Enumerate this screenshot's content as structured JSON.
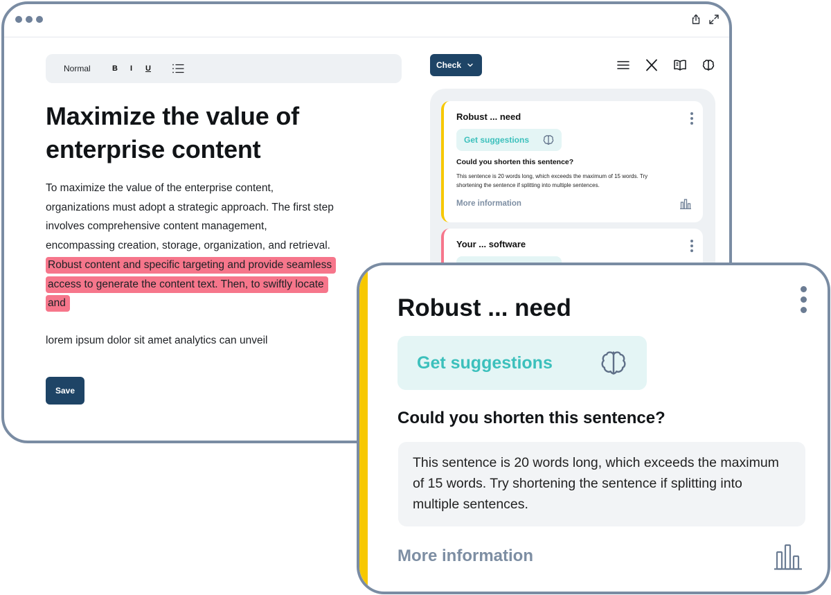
{
  "toolbar": {
    "style_label": "Normal",
    "bold": "B",
    "italic": "I",
    "underline": "U"
  },
  "document": {
    "title": "Maximize the value of enterprise content",
    "body_plain": "To maximize the value of the enterprise content, organizations must adopt a strategic approach. The first step involves comprehensive content management, encompassing creation, storage, organization, and retrieval.",
    "body_highlight": "Robust content and specific targeting and provide seamless access to generate the content text. Then, to swiftly locate and",
    "extra": "lorem ipsum dolor sit amet analytics can unveil",
    "save_label": "Save"
  },
  "panel": {
    "check_label": "Check",
    "cards": [
      {
        "title": "Robust ... need",
        "suggest_label": "Get suggestions",
        "question": "Could you shorten this sentence?",
        "description": "This sentence is 20 words long, which exceeds the maximum of 15 words. Try shortening the sentence if splitting into multiple sentences.",
        "more_label": "More information",
        "accent": "#f7c800"
      },
      {
        "title": "Your ... software",
        "accent": "#f6768b"
      }
    ]
  },
  "zoom": {
    "title": "Robust ... need",
    "suggest_label": "Get suggestions",
    "question": "Could you shorten this sentence?",
    "description": "This sentence is 20 words long, which exceeds the maximum of 15 words. Try shortening the sentence if splitting into multiple sentences.",
    "more_label": "More information"
  },
  "colors": {
    "primary": "#1e4466",
    "highlight": "#f6768b",
    "accent_yellow": "#f7c800",
    "teal": "#3cc0bc",
    "muted": "#7d8ea3",
    "frame": "#7a8ca3"
  },
  "icons": [
    "share-icon",
    "expand-icon",
    "list-icon",
    "chevron-down-icon",
    "menu-icon",
    "x-logo-icon",
    "book-icon",
    "brain-icon",
    "bar-chart-icon"
  ]
}
